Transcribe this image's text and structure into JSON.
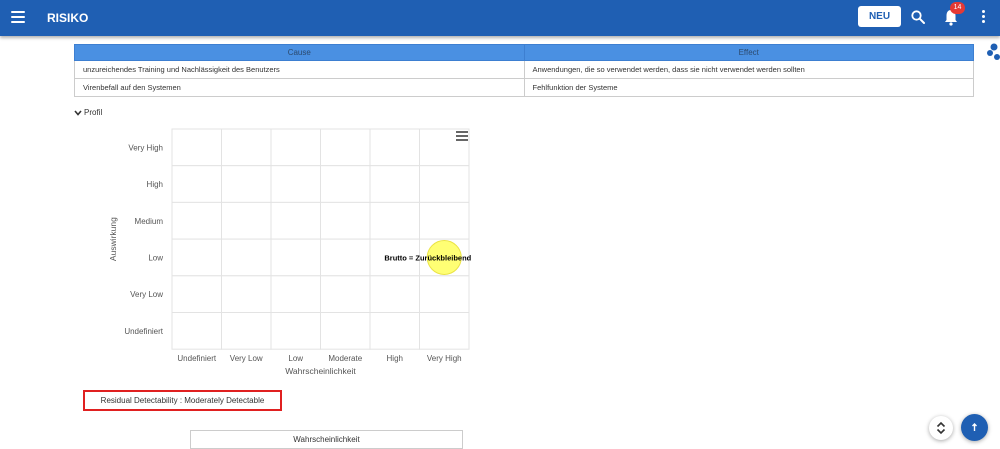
{
  "header": {
    "title": "RISIKO",
    "new_button": "NEU",
    "notification_count": "14",
    "icons": [
      "menu-icon",
      "search-icon",
      "bell-icon",
      "more-vert-icon"
    ]
  },
  "cause_effect": {
    "headers": {
      "cause": "Cause",
      "effect": "Effect"
    },
    "rows": [
      {
        "cause": "unzureichendes Training und Nachlässigkeit des Benutzers",
        "effect": "Anwendungen, die so verwendet werden, dass sie nicht verwendet werden sollten"
      },
      {
        "cause": "Virenbefall auf den Systemen",
        "effect": "Fehlfunktion der Systeme"
      }
    ]
  },
  "profile": {
    "toggle_label": "Profil"
  },
  "chart_data": {
    "type": "heatmap",
    "xlabel": "Wahrscheinlichkeit",
    "ylabel": "Auswirkung",
    "x_categories": [
      "Undefiniert",
      "Very Low",
      "Low",
      "Moderate",
      "High",
      "Very High"
    ],
    "y_categories": [
      "Very High",
      "High",
      "Medium",
      "Low",
      "Very Low",
      "Undefiniert"
    ],
    "points": [
      {
        "label": "Brutto = Zurückbleibend",
        "x": "Very High",
        "y": "Low",
        "color": "#ffff66"
      }
    ],
    "grid": true
  },
  "residual": {
    "label": "Residual Detectability : Moderately Detectable"
  },
  "bottom_table": {
    "header": "Wahrscheinlichkeit"
  },
  "colors": {
    "header_bg": "#1f5fb3",
    "table_header": "#4a90e2",
    "highlight_border": "#e02020"
  }
}
